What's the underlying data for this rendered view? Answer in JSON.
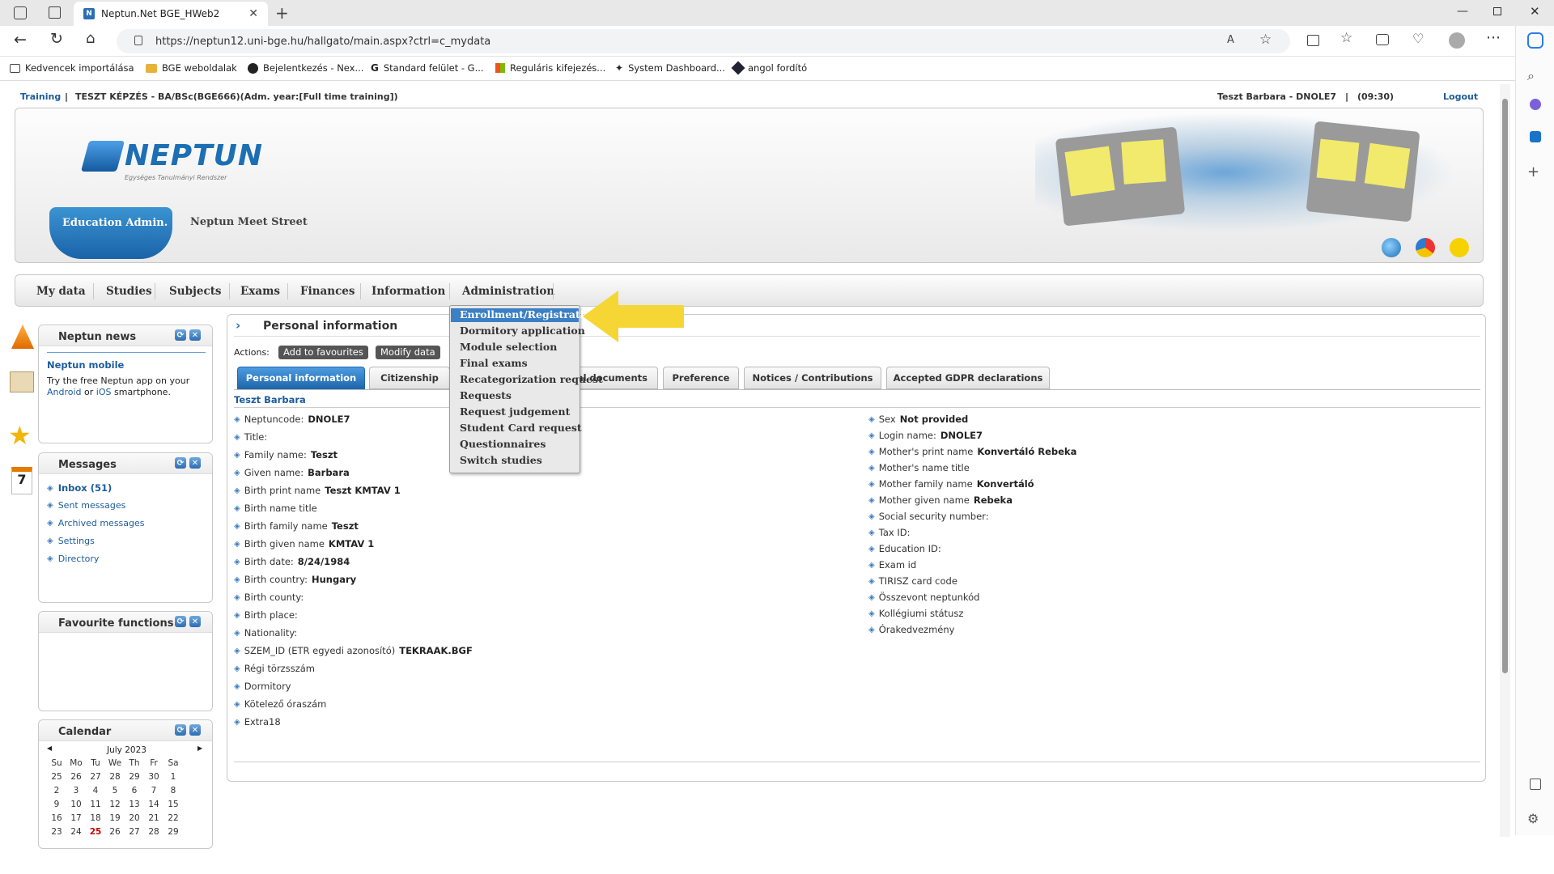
{
  "browser": {
    "tab_title": "Neptun.Net BGE_HWeb2",
    "url": "https://neptun12.uni-bge.hu/hallgato/main.aspx?ctrl=c_mydata",
    "bookmarks": [
      "Kedvencek importálása",
      "BGE weboldalak",
      "Bejelentkezés - Nex...",
      "Standard felület - G...",
      "Reguláris kifejezés...",
      "System Dashboard...",
      "angol fordító"
    ]
  },
  "topbar": {
    "training_link": "Training",
    "training_text": "TESZT KÉPZÉS - BA/BSc(BGE666)(Adm. year:[Full time training])",
    "user_text": "Teszt Barbara - DNOLE7",
    "timer": "(09:30)",
    "logout": "Logout"
  },
  "header": {
    "logo": "NEPTUN",
    "logo_sub": "Egységes Tanulmányi Rendszer",
    "edu_admin": "Education Admin.",
    "meet_street": "Neptun Meet Street"
  },
  "menu": {
    "items": [
      "My data",
      "Studies",
      "Subjects",
      "Exams",
      "Finances",
      "Information",
      "Administration"
    ],
    "dropdown": [
      "Enrollment/Registration",
      "Dormitory application",
      "Module selection",
      "Final exams",
      "Recategorization request",
      "Requests",
      "Request judgement",
      "Student Card request",
      "Questionnaires",
      "Switch studies"
    ]
  },
  "news": {
    "title": "Neptun news",
    "mobile_title": "Neptun mobile",
    "text1": "Try the free Neptun app on your",
    "android": "Android",
    "or": "or",
    "ios": "iOS",
    "text2": "smartphone."
  },
  "messages": {
    "title": "Messages",
    "items": [
      "Inbox (51)",
      "Sent messages",
      "Archived messages",
      "Settings",
      "Directory"
    ]
  },
  "favourites": {
    "title": "Favourite functions"
  },
  "calendar": {
    "title": "Calendar",
    "month": "July 2023",
    "days": [
      "Su",
      "Mo",
      "Tu",
      "We",
      "Th",
      "Fr",
      "Sa"
    ],
    "weeks": [
      [
        "25",
        "26",
        "27",
        "28",
        "29",
        "30",
        "1"
      ],
      [
        "2",
        "3",
        "4",
        "5",
        "6",
        "7",
        "8"
      ],
      [
        "9",
        "10",
        "11",
        "12",
        "13",
        "14",
        "15"
      ],
      [
        "16",
        "17",
        "18",
        "19",
        "20",
        "21",
        "22"
      ],
      [
        "23",
        "24",
        "25",
        "26",
        "27",
        "28",
        "29"
      ]
    ],
    "today": "25"
  },
  "main": {
    "title": "Personal information",
    "actions_label": "Actions:",
    "add_fav": "Add to favourites",
    "modify": "Modify data",
    "tabs": [
      "Personal information",
      "Citizenship",
      "al documents",
      "Preference",
      "Notices / Contributions",
      "Accepted GDPR declarations"
    ],
    "name": "Teszt Barbara",
    "left_fields": [
      {
        "label": "Neptuncode:",
        "value": "DNOLE7"
      },
      {
        "label": "Title:",
        "value": ""
      },
      {
        "label": "Family name:",
        "value": "Teszt"
      },
      {
        "label": "Given name:",
        "value": "Barbara"
      },
      {
        "label": "Birth print name",
        "value": "Teszt KMTAV 1"
      },
      {
        "label": "Birth name title",
        "value": ""
      },
      {
        "label": "Birth family name",
        "value": "Teszt"
      },
      {
        "label": "Birth given name",
        "value": "KMTAV 1"
      },
      {
        "label": "Birth date:",
        "value": "8/24/1984"
      },
      {
        "label": "Birth country:",
        "value": "Hungary"
      },
      {
        "label": "Birth county:",
        "value": ""
      },
      {
        "label": "Birth place:",
        "value": ""
      },
      {
        "label": "Nationality:",
        "value": ""
      },
      {
        "label": "SZEM_ID (ETR egyedi azonosító)",
        "value": "TEKRAAK.BGF"
      },
      {
        "label": "Régi törzsszám",
        "value": ""
      },
      {
        "label": "Dormitory",
        "value": ""
      },
      {
        "label": "Kötelező óraszám",
        "value": ""
      },
      {
        "label": "Extra18",
        "value": ""
      }
    ],
    "right_fields": [
      {
        "label": "Sex",
        "value": "Not provided"
      },
      {
        "label": "Login name:",
        "value": "DNOLE7"
      },
      {
        "label": "Mother's print name",
        "value": "Konvertáló Rebeka"
      },
      {
        "label": "Mother's name title",
        "value": ""
      },
      {
        "label": "Mother family name",
        "value": "Konvertáló"
      },
      {
        "label": "Mother given name",
        "value": "Rebeka"
      },
      {
        "label": "Social security number:",
        "value": ""
      },
      {
        "label": "Tax ID:",
        "value": ""
      },
      {
        "label": "Education ID:",
        "value": ""
      },
      {
        "label": "Exam id",
        "value": ""
      },
      {
        "label": "TIRISZ card code",
        "value": ""
      },
      {
        "label": "Összevont neptunkód",
        "value": ""
      },
      {
        "label": "Kollégiumi státusz",
        "value": ""
      },
      {
        "label": "Órakedvezmény",
        "value": ""
      }
    ]
  },
  "colors": {
    "accent": "#1f67ad",
    "highlight_arrow": "#f5d634"
  }
}
